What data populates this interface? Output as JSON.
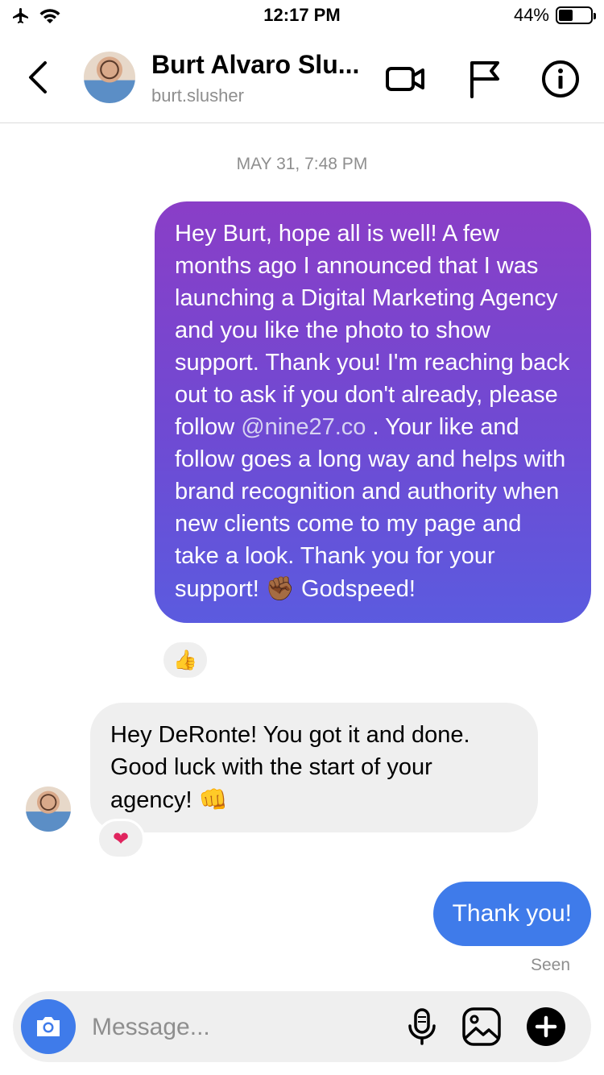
{
  "status_bar": {
    "time": "12:17 PM",
    "battery": "44%",
    "battery_level": 0.44
  },
  "header": {
    "name": "Burt Alvaro Slu...",
    "username": "burt.slusher"
  },
  "conversation": {
    "date_stamp": "MAY 31, 7:48 PM",
    "outgoing_message": {
      "text_before_mention": "Hey Burt, hope all is well! A few months ago I announced that I was launching a Digital Marketing Agency and you like the photo to show support. Thank you! I'm reaching back out to ask if you don't already, please follow ",
      "mention": "@nine27.co",
      "text_after_mention": " . Your like and follow goes a long way and helps with brand recognition and authority when new clients come to my page and take a look. Thank you for your support! ",
      "emoji": "✊🏾",
      "text_end": " Godspeed!",
      "reaction": "👍"
    },
    "incoming_message": {
      "text": "Hey DeRonte! You got it and done. Good luck with the start of your agency! ",
      "emoji": "👊",
      "reaction": "❤"
    },
    "reply_message": {
      "text": "Thank you!"
    },
    "seen_label": "Seen"
  },
  "composer": {
    "placeholder": "Message..."
  },
  "colors": {
    "outgoing_gradient_top": "#8a3ec7",
    "outgoing_gradient_bottom": "#5b5bdf",
    "reply_bubble": "#3f7bea",
    "incoming_bubble": "#efefef",
    "camera_button": "#3f7bea"
  },
  "icons": {
    "status": [
      "airplane-icon",
      "wifi-icon",
      "battery-icon"
    ],
    "header": [
      "back-chevron-icon",
      "video-call-icon",
      "flag-icon",
      "info-icon"
    ],
    "composer": [
      "camera-icon",
      "microphone-icon",
      "gallery-icon",
      "plus-icon"
    ]
  }
}
